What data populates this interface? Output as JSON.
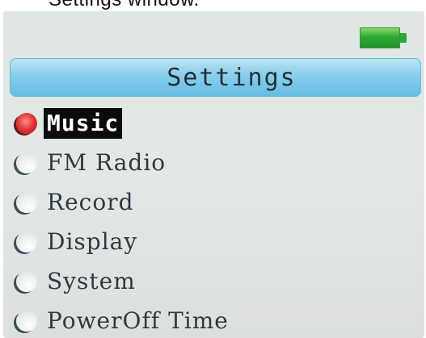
{
  "caption": "Settings window.",
  "status": {
    "battery_icon": "battery-full-icon",
    "battery_color": "#2ea836"
  },
  "header": {
    "title": "Settings"
  },
  "menu": {
    "items": [
      {
        "label": "Music",
        "selected": true
      },
      {
        "label": "FM Radio",
        "selected": false
      },
      {
        "label": "Record",
        "selected": false
      },
      {
        "label": "Display",
        "selected": false
      },
      {
        "label": "System",
        "selected": false
      },
      {
        "label": "PowerOff Time",
        "selected": false
      }
    ]
  },
  "colors": {
    "title_bar": "#63bde3",
    "selection_bg": "#0b0b0b",
    "active_radio": "#e23232"
  }
}
